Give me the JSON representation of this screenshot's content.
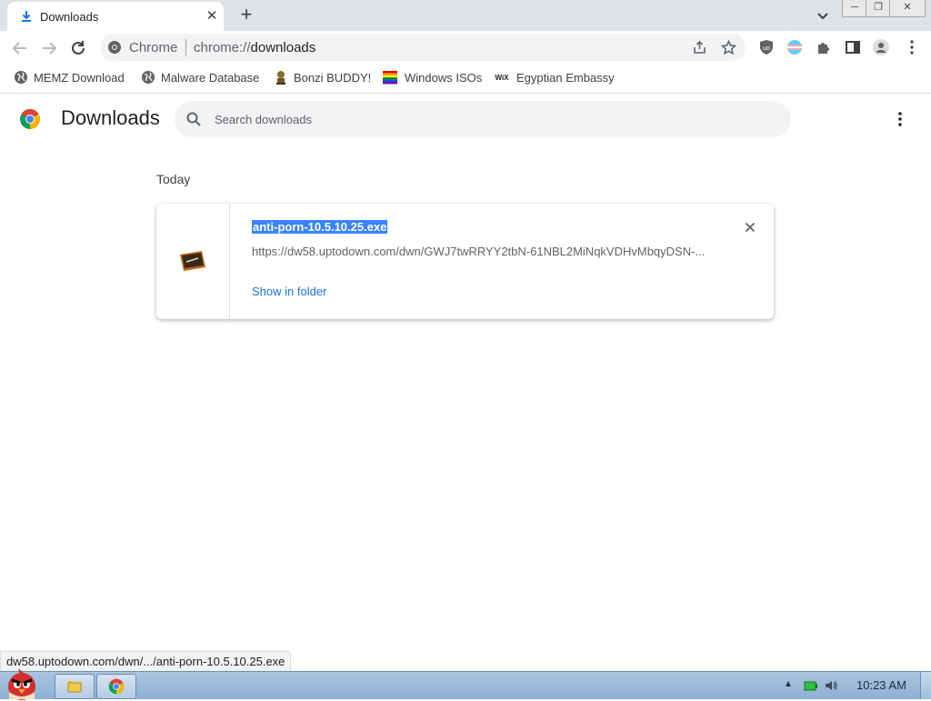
{
  "tab": {
    "title": "Downloads",
    "close": "✕",
    "new": "+"
  },
  "omnibox": {
    "chip": "Chrome",
    "scheme": "chrome://",
    "path": "downloads"
  },
  "bookmarks": [
    {
      "label": "MEMZ Download",
      "icon": "globe-icon"
    },
    {
      "label": "Malware Database",
      "icon": "globe-icon"
    },
    {
      "label": "Bonzi BUDDY!",
      "icon": "bonzi-icon"
    },
    {
      "label": "Windows ISOs",
      "icon": "rainbow-flag-icon"
    },
    {
      "label": "Egyptian Embassy",
      "icon": "wix-icon"
    }
  ],
  "page": {
    "title": "Downloads",
    "search_placeholder": "Search downloads",
    "section_date": "Today"
  },
  "download": {
    "filename": "anti-porn-10.5.10.25.exe",
    "url": "https://dw58.uptodown.com/dwn/GWJ7twRRYY2tbN-61NBL2MiNqkVDHvMbqyDSN-...",
    "action": "Show in folder"
  },
  "status_bar": "dw58.uptodown.com/dwn/.../anti-porn-10.5.10.25.exe",
  "taskbar": {
    "clock": "10:23 AM"
  },
  "colors": {
    "accent": "#1a73e8",
    "selection": "#3a84ff",
    "tabstrip": "#dee1e6"
  }
}
